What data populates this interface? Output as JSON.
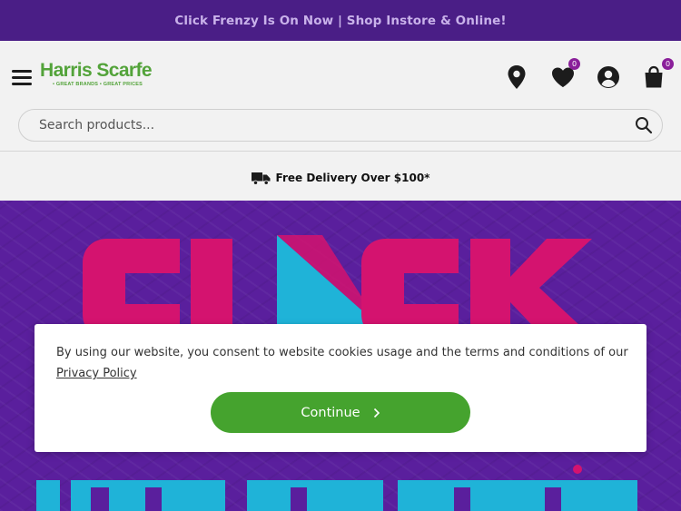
{
  "promo": {
    "text": "Click Frenzy Is On Now | Shop Instore & Online!"
  },
  "header": {
    "logo": {
      "name": "Harris Scarfe",
      "tagline": "• GREAT BRANDS • GREAT PRICES"
    },
    "wishlist_count": "0",
    "cart_count": "0"
  },
  "search": {
    "placeholder": "Search products..."
  },
  "delivery": {
    "text": "Free Delivery Over $100*"
  },
  "cookie": {
    "text": "By using our website, you consent to website cookies usage and the terms and conditions of our ",
    "link": "Privacy Policy",
    "button": "Continue"
  },
  "colors": {
    "promo_bg": "#4a1e86",
    "brand_green": "#53a33a",
    "button_green": "#45a32e",
    "hero_purple": "#5a1f9d",
    "hero_pink": "#d4136f",
    "hero_cyan": "#1fb3d8",
    "badge": "#8a1f9a"
  },
  "icons": [
    "menu-icon",
    "location-pin-icon",
    "heart-icon",
    "user-icon",
    "shopping-bag-icon",
    "search-icon",
    "truck-icon",
    "chevron-right-icon"
  ]
}
